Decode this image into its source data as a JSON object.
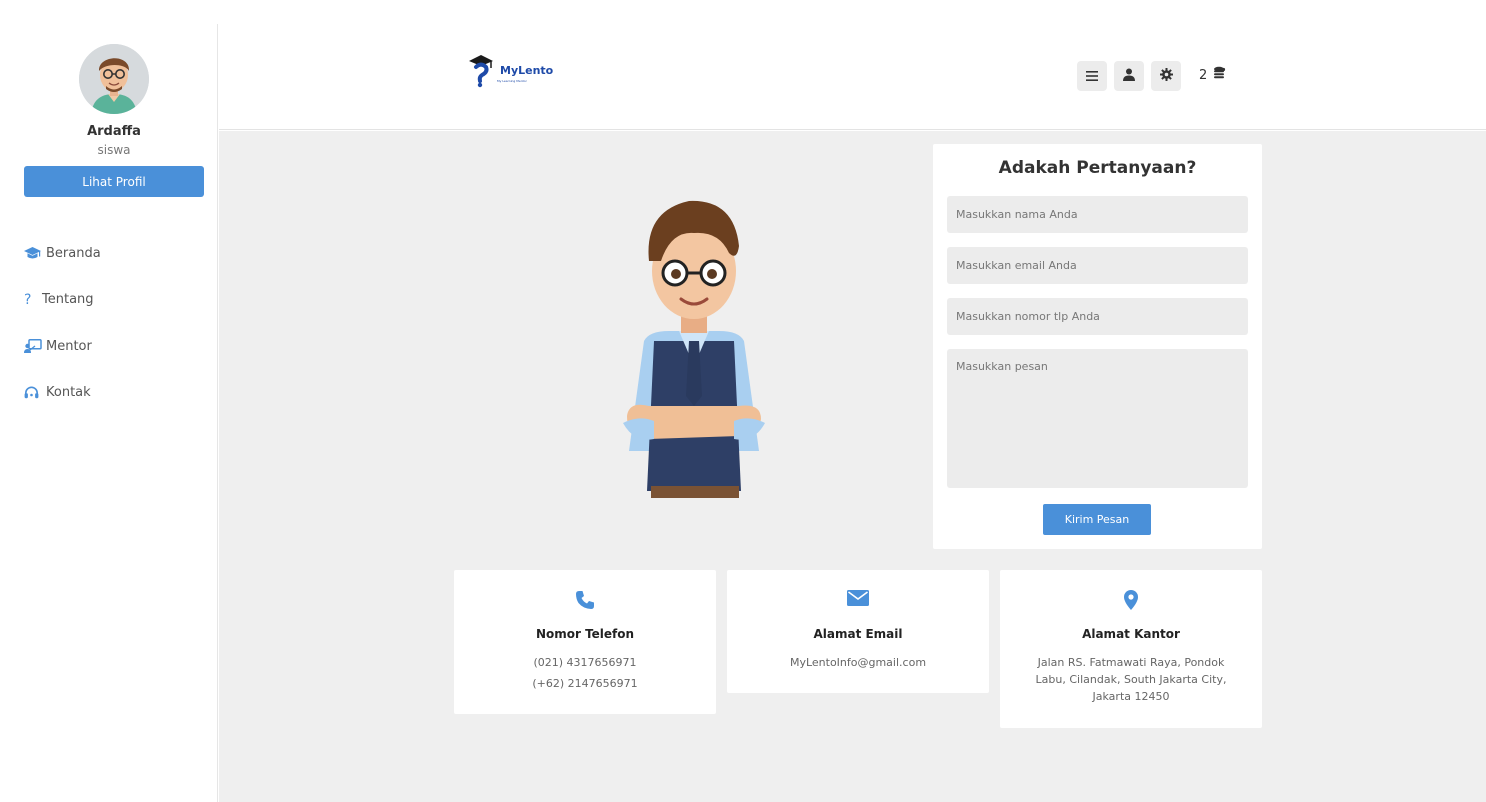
{
  "user": {
    "name": "Ardaffa",
    "role": "siswa",
    "profile_button": "Lihat Profil"
  },
  "nav": [
    {
      "label": "Beranda",
      "icon": "graduation-cap-icon"
    },
    {
      "label": "Tentang",
      "icon": "question-icon"
    },
    {
      "label": "Mentor",
      "icon": "teacher-icon"
    },
    {
      "label": "Kontak",
      "icon": "headset-icon"
    }
  ],
  "header": {
    "logo_text": "MyLento",
    "logo_subtitle": "My Learning Mentor",
    "coin_count": "2"
  },
  "contact_form": {
    "title": "Adakah Pertanyaan?",
    "name_placeholder": "Masukkan nama Anda",
    "email_placeholder": "Masukkan email Anda",
    "phone_placeholder": "Masukkan nomor tlp Anda",
    "message_placeholder": "Masukkan pesan",
    "submit_label": "Kirim Pesan"
  },
  "info_cards": {
    "phone": {
      "title": "Nomor Telefon",
      "line1": "(021) 4317656971",
      "line2": "(+62) 2147656971"
    },
    "email": {
      "title": "Alamat Email",
      "line1": "MyLentoInfo@gmail.com"
    },
    "office": {
      "title": "Alamat Kantor",
      "line1": "Jalan RS. Fatmawati Raya, Pondok",
      "line2": "Labu, Cilandak, South Jakarta City,",
      "line3": "Jakarta 12450"
    }
  },
  "colors": {
    "accent": "#4a90d9",
    "main_background": "#efefef"
  }
}
